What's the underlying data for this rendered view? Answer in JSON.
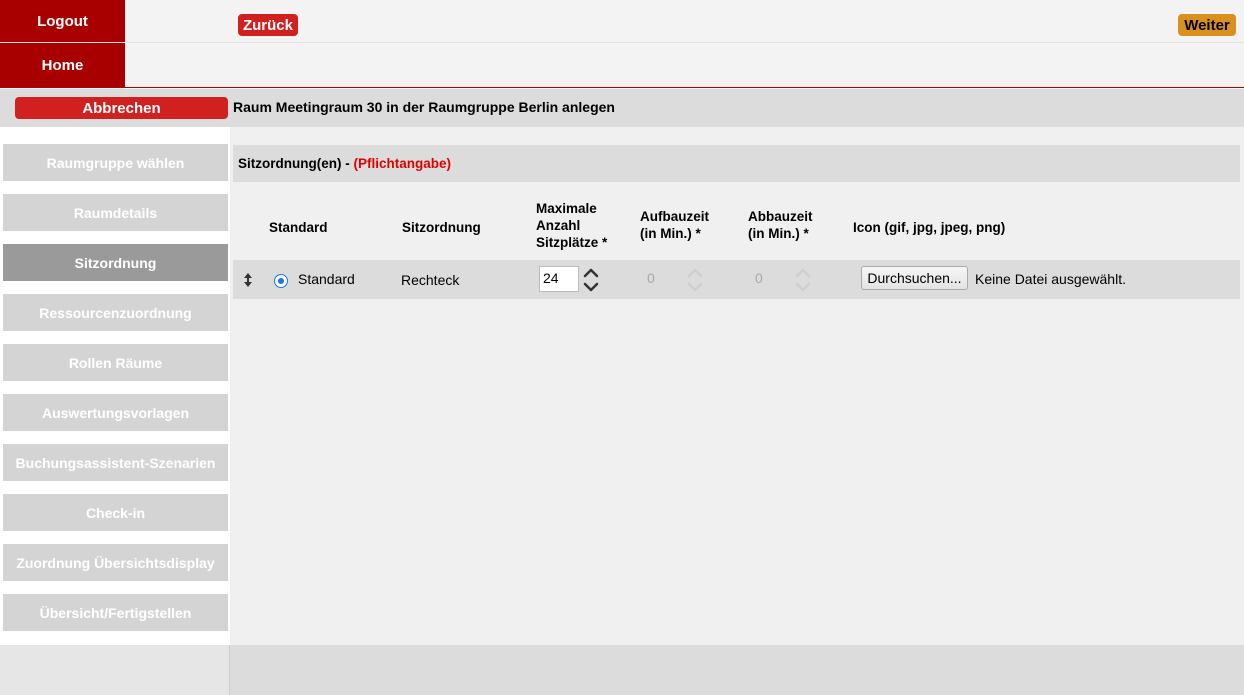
{
  "topnav": {
    "logout": "Logout",
    "home": "Home"
  },
  "header": {
    "cancel": "Abbrechen",
    "title": "Raum Meetingraum 30 in der Raumgruppe Berlin anlegen"
  },
  "steps": [
    "Raumgruppe wählen",
    "Raumdetails",
    "Sitzordnung",
    "Ressourcenzuordnung",
    "Rollen Räume",
    "Auswertungsvorlagen",
    "Buchungsassistent-Szenarien",
    "Check-in",
    "Zuordnung Übersichtsdisplay",
    "Übersicht/Fertigstellen"
  ],
  "active_step": "Sitzordnung",
  "section": {
    "title": "Sitzordnung(en) - ",
    "required": "(Pflichtangabe)"
  },
  "table": {
    "headers": {
      "standard": "Standard",
      "sitzordnung": "Sitzordnung",
      "max_l1": "Maximale",
      "max_l2": "Anzahl",
      "max_l3": "Sitzplätze *",
      "aufbau_l1": "Aufbauzeit",
      "aufbau_l2": "(in Min.) *",
      "abbau_l1": "Abbauzeit",
      "abbau_l2": "(in Min.) *",
      "icon": "Icon (gif, jpg, jpeg, png)"
    },
    "row": {
      "standard_label": "Standard",
      "sitzordnung": "Rechteck",
      "max_seats": "24",
      "aufbau": "0",
      "abbau": "0",
      "file_button": "Durchsuchen...",
      "file_status": "Keine Datei ausgewählt."
    }
  },
  "footer": {
    "back": "Zurück",
    "next": "Weiter"
  },
  "colors": {
    "brand_red": "#a80000",
    "button_red": "#d02020",
    "next_orange": "#d9901e",
    "required_red": "#e00000"
  }
}
